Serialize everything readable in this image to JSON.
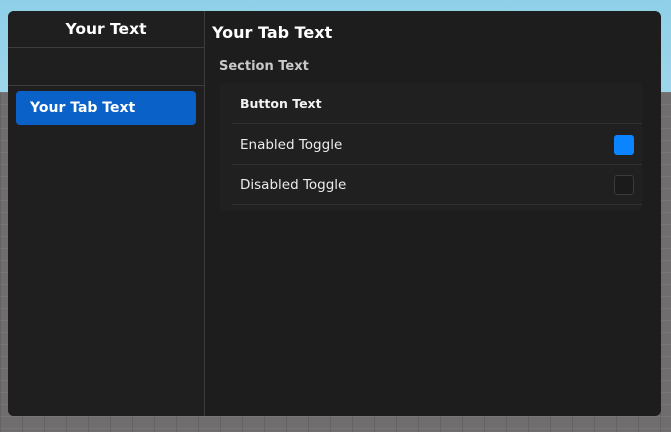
{
  "sidebar": {
    "title": "Your Text",
    "tabs": [
      {
        "label": "Your Tab Text",
        "active": true
      }
    ]
  },
  "main": {
    "tab_title": "Your Tab Text",
    "section": {
      "title": "Section Text",
      "button": {
        "label": "Button Text"
      },
      "toggles": [
        {
          "label": "Enabled Toggle",
          "checked": true
        },
        {
          "label": "Disabled Toggle",
          "checked": false
        }
      ]
    }
  },
  "colors": {
    "accent": "#0a84ff",
    "active_tab": "#0a62c8",
    "window_bg": "#1d1d1d"
  }
}
